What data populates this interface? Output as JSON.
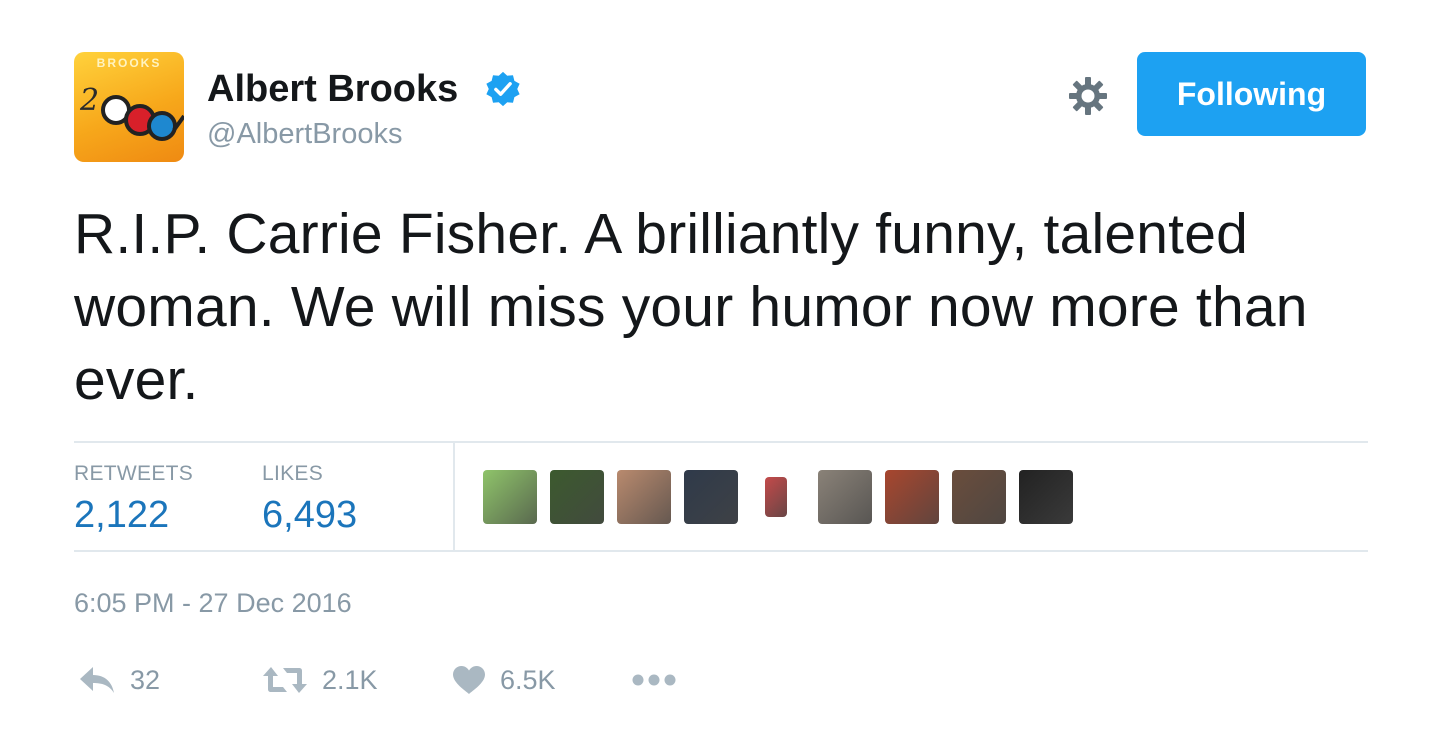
{
  "author": {
    "avatar_brand": "BROOKS",
    "display_name": "Albert Brooks",
    "handle": "@AlbertBrooks",
    "verified": true
  },
  "header": {
    "settings_icon": "gear-icon",
    "follow_label": "Following"
  },
  "tweet": {
    "text": "R.I.P. Carrie Fisher. A brilliantly funny, talented woman. We will miss your humor now more than ever.",
    "timestamp": "6:05 PM - 27 Dec 2016"
  },
  "stats": {
    "retweets_label": "RETWEETS",
    "retweets_value": "2,122",
    "likes_label": "LIKES",
    "likes_value": "6,493",
    "likers": [
      "#8fc46a",
      "#3c5a2e",
      "#b98a6e",
      "#2f3a4a",
      "#c44a4a",
      "#8a8278",
      "#a8462e",
      "#6a4d3c",
      "#222222"
    ]
  },
  "actions": {
    "reply_count": "32",
    "retweet_count": "2.1K",
    "like_count": "6.5K",
    "more_icon": "more-dots-icon"
  },
  "colors": {
    "accent": "#1da1f2",
    "stat_value": "#1b75bb",
    "muted": "#8899a6",
    "verified": "#1da1f2"
  }
}
